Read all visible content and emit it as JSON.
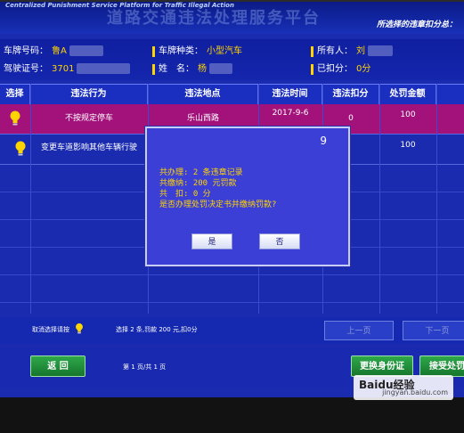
{
  "header": {
    "system_title_en": "Centralized Punishment Service Platform for Traffic Illegal Action",
    "system_title_cn": "道路交通违法处理服务平台",
    "selected_tip": "所选择的违章扣分总："
  },
  "vehicle_info": {
    "plate_label": "车牌号码：",
    "plate_value": "鲁A",
    "plate_type_label": "车牌种类：",
    "plate_type_value": "小型汽车",
    "owner_label": "所有人：",
    "owner_value": "刘",
    "license_label": "驾驶证号：",
    "license_value": "3701",
    "name_label": "姓　名：",
    "name_value": "杨",
    "points_label": "已扣分：",
    "points_value": "0分"
  },
  "table": {
    "columns": [
      "选择",
      "违法行为",
      "违法地点",
      "违法时间",
      "违法扣分",
      "处罚金额"
    ],
    "rows": [
      {
        "violation": "不按规定停车",
        "location": "乐山西路",
        "time": "2017-9-6",
        "points": "0",
        "fine": "100",
        "selected": true
      },
      {
        "violation": "变更车道影响其他车辆行驶",
        "location": "",
        "time": "",
        "points": "",
        "fine": "100",
        "selected": false
      }
    ]
  },
  "footer": {
    "clear_selection": "取消选择请按",
    "summary": "选择 2 条,罚款 200 元,扣0分",
    "prev_page": "上一页",
    "next_page": "下一页",
    "back": "返 回",
    "page_info": "第 1 页/共 1 页",
    "change_id": "更换身份证",
    "accept": "接受处罚"
  },
  "dialog": {
    "countdown": "9",
    "line1": "共办理: 2 条违章记录",
    "line2": "共缴纳: 200 元罚款",
    "line3": "共　扣: 0 分",
    "line4": "是否办理处罚决定书并缴纳罚款?",
    "yes": "是",
    "no": "否"
  },
  "watermark": {
    "brand": "Baidu经验",
    "url": "jingyan.baidu.com"
  },
  "colors": {
    "screen_bg": "#1b2bb0",
    "selected_row": "#a2127a",
    "accent_yellow": "#ffd400",
    "button_green": "#2ea84a"
  }
}
